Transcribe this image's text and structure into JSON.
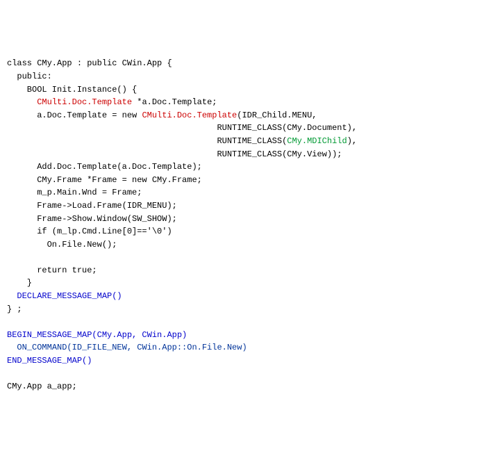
{
  "code": {
    "l01_a": "class CMy.App : public CWin.App {",
    "l02_a": "  public:",
    "l03_a": "    BOOL Init.Instance() {",
    "l04_a": "      ",
    "l04_b": "CMulti.Doc.Template",
    "l04_c": " *a.Doc.Template;",
    "l05_a": "      a.Doc.Template = new ",
    "l05_b": "CMulti.Doc.Template",
    "l05_c": "(IDR_Child.MENU,",
    "l06_a": "                                          RUNTIME_CLASS(CMy.Document),",
    "l07_a": "                                          RUNTIME_CLASS(",
    "l07_b": "CMy.MDIChild",
    "l07_c": "),",
    "l08_a": "                                          RUNTIME_CLASS(CMy.View));",
    "l09_a": "      Add.Doc.Template(a.Doc.Template);",
    "l10_a": "      CMy.Frame *Frame = new CMy.Frame;",
    "l11_a": "      m_p.Main.Wnd = Frame;",
    "l12_a": "      Frame->Load.Frame(IDR_MENU);",
    "l13_a": "      Frame->Show.Window(SW_SHOW);",
    "l14_a": "      if (m_lp.Cmd.Line[0]=='\\0')",
    "l15_a": "        On.File.New();",
    "l16_a": "",
    "l17_a": "      return true;",
    "l18_a": "    }",
    "l19_a": "  ",
    "l19_b": "DECLARE_MESSAGE_MAP()",
    "l20_a": "} ;",
    "l21_a": "",
    "l22_a": "BEGIN_MESSAGE_MAP(CMy.App, CWin.App)",
    "l23_a": "  ",
    "l23_b": "ON_COMMAND(ID_FILE_NEW, CWin.App::On.File.New)",
    "l24_a": "END_MESSAGE_MAP()",
    "l25_a": "",
    "l26_a": "CMy.App a_app;"
  }
}
